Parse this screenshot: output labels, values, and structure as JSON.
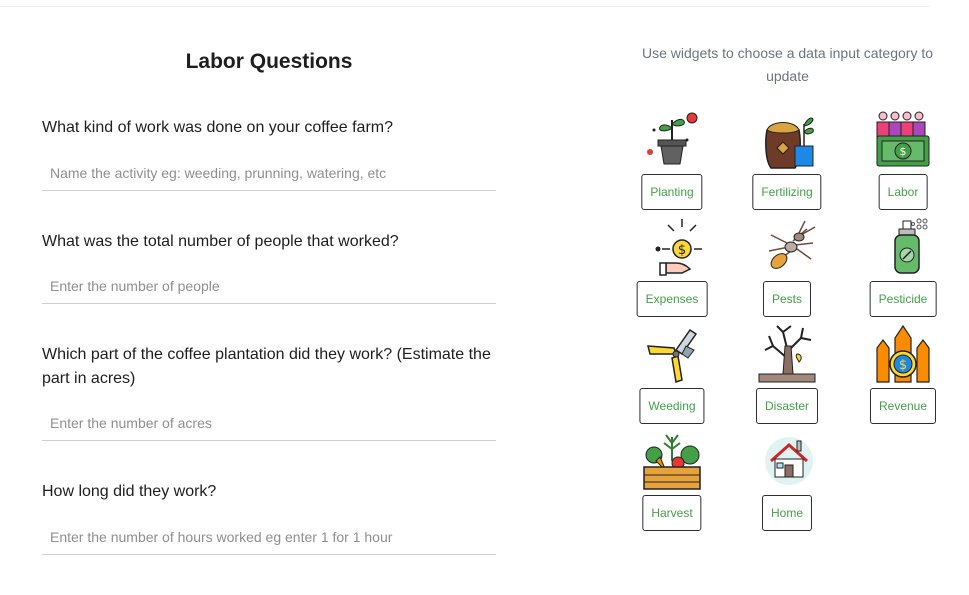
{
  "form": {
    "title": "Labor Questions",
    "questions": [
      {
        "label": "What kind of work was done on your coffee farm?",
        "placeholder": "Name the activity eg: weeding, prunning, watering, etc",
        "value": ""
      },
      {
        "label": "What was the total number of people that worked?",
        "placeholder": "Enter the number of people",
        "value": ""
      },
      {
        "label": "Which part of the coffee plantation did they work? (Estimate the part in acres)",
        "placeholder": "Enter the number of acres",
        "value": ""
      },
      {
        "label": "How long did they work?",
        "placeholder": "Enter the number of hours worked eg enter 1 for 1 hour",
        "value": ""
      }
    ]
  },
  "widgets": {
    "instruction": "Use widgets to choose a data input category to update",
    "items": [
      {
        "label": "Planting",
        "icon": "plant-pot-icon"
      },
      {
        "label": "Fertilizing",
        "icon": "fertilizer-sack-icon"
      },
      {
        "label": "Labor",
        "icon": "workers-money-icon"
      },
      {
        "label": "Expenses",
        "icon": "hand-coin-icon"
      },
      {
        "label": "Pests",
        "icon": "termite-icon"
      },
      {
        "label": "Pesticide",
        "icon": "spray-bottle-icon"
      },
      {
        "label": "Weeding",
        "icon": "pruning-shears-icon"
      },
      {
        "label": "Disaster",
        "icon": "dead-tree-icon"
      },
      {
        "label": "Revenue",
        "icon": "revenue-arrows-icon"
      },
      {
        "label": "Harvest",
        "icon": "vegetable-crate-icon"
      },
      {
        "label": "Home",
        "icon": "house-icon"
      }
    ]
  }
}
